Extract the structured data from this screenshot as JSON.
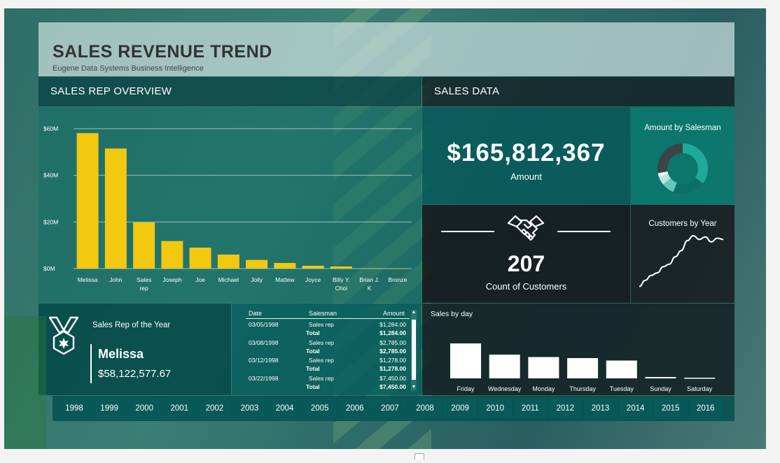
{
  "header": {
    "title": "SALES REVENUE TREND",
    "subtitle": "Eugene Data Systems Business Intelligence"
  },
  "sections": {
    "rep_overview": "SALES REP OVERVIEW",
    "sales_data": "SALES DATA"
  },
  "kpis": {
    "amount_value": "$165,812,367",
    "amount_label": "Amount",
    "customers_value": "207",
    "customers_label": "Count of Customers"
  },
  "donut": {
    "title": "Amount by Salesman",
    "segments": [
      {
        "value": 35,
        "color": "#1fa99a"
      },
      {
        "value": 21,
        "color": "#0d6e68"
      },
      {
        "value": 8,
        "color": "#66c7bb"
      },
      {
        "value": 5,
        "color": "#b9e6df"
      },
      {
        "value": 3,
        "color": "#e6f5f2"
      },
      {
        "value": 28,
        "color": "#3b4446"
      }
    ]
  },
  "customers_by_year": {
    "title": "Customers by Year",
    "values": [
      3,
      8,
      12,
      14,
      19,
      21,
      27,
      32,
      40,
      44,
      41,
      43,
      39,
      42,
      41
    ]
  },
  "rep_of_year": {
    "label": "Sales Rep of the Year",
    "name": "Melissa",
    "amount": "$58,122,577.67"
  },
  "table": {
    "headers": [
      "Date",
      "Salesman",
      "Amount"
    ],
    "rows": [
      {
        "date": "03/05/1998",
        "salesman": "Sales rep",
        "amount": "$1,284.00",
        "total_label": "Total",
        "total": "$1,284.00"
      },
      {
        "date": "03/08/1998",
        "salesman": "Sales rep",
        "amount": "$2,785.00",
        "total_label": "Total",
        "total": "$2,785.00"
      },
      {
        "date": "03/12/1998",
        "salesman": "Sales rep",
        "amount": "$1,278.00",
        "total_label": "Total",
        "total": "$1,278.00"
      },
      {
        "date": "03/22/1998",
        "salesman": "Sales rep",
        "amount": "$7,450.00",
        "total_label": "Total",
        "total": "$7,450.00"
      }
    ]
  },
  "years": [
    "1998",
    "1999",
    "2000",
    "2001",
    "2002",
    "2003",
    "2004",
    "2005",
    "2006",
    "2007",
    "2008",
    "2009",
    "2010",
    "2011",
    "2012",
    "2013",
    "2014",
    "2015",
    "2016"
  ],
  "chart_data": [
    {
      "type": "bar",
      "title": "",
      "categories": [
        "Melissa",
        "John",
        "Sales rep",
        "Joseph",
        "Joe",
        "Michael",
        "Jolly",
        "Mattew",
        "Joyce",
        "Billy Y. Choi",
        "Brian J. K",
        "Bronze"
      ],
      "category_lines": [
        [
          "Melissa"
        ],
        [
          "John"
        ],
        [
          "Sales",
          "rep"
        ],
        [
          "Joseph"
        ],
        [
          "Joe"
        ],
        [
          "Michael"
        ],
        [
          "Jolly"
        ],
        [
          "Mattew"
        ],
        [
          "Joyce"
        ],
        [
          "Billy Y.",
          "Choi"
        ],
        [
          "Brian J.",
          "K"
        ],
        [
          "Bronze"
        ]
      ],
      "values": [
        58.1,
        51.5,
        19.8,
        11.8,
        9.0,
        6.0,
        3.7,
        2.4,
        1.2,
        0.9,
        0.1,
        0.05
      ],
      "unit": "$M",
      "yticks": [
        {
          "value": 0,
          "label": "$0M"
        },
        {
          "value": 20,
          "label": "$20M"
        },
        {
          "value": 40,
          "label": "$40M"
        },
        {
          "value": 60,
          "label": "$60M"
        }
      ],
      "ylim": [
        0,
        60
      ],
      "grid": true,
      "color": "#f2c811"
    },
    {
      "type": "bar",
      "title": "Sales by day",
      "categories": [
        "Friday",
        "Wednesday",
        "Monday",
        "Thursday",
        "Tuesday",
        "Sunday",
        "Saturday"
      ],
      "values": [
        100,
        68,
        61,
        58,
        51,
        4,
        2
      ],
      "color": "#ffffff"
    }
  ]
}
